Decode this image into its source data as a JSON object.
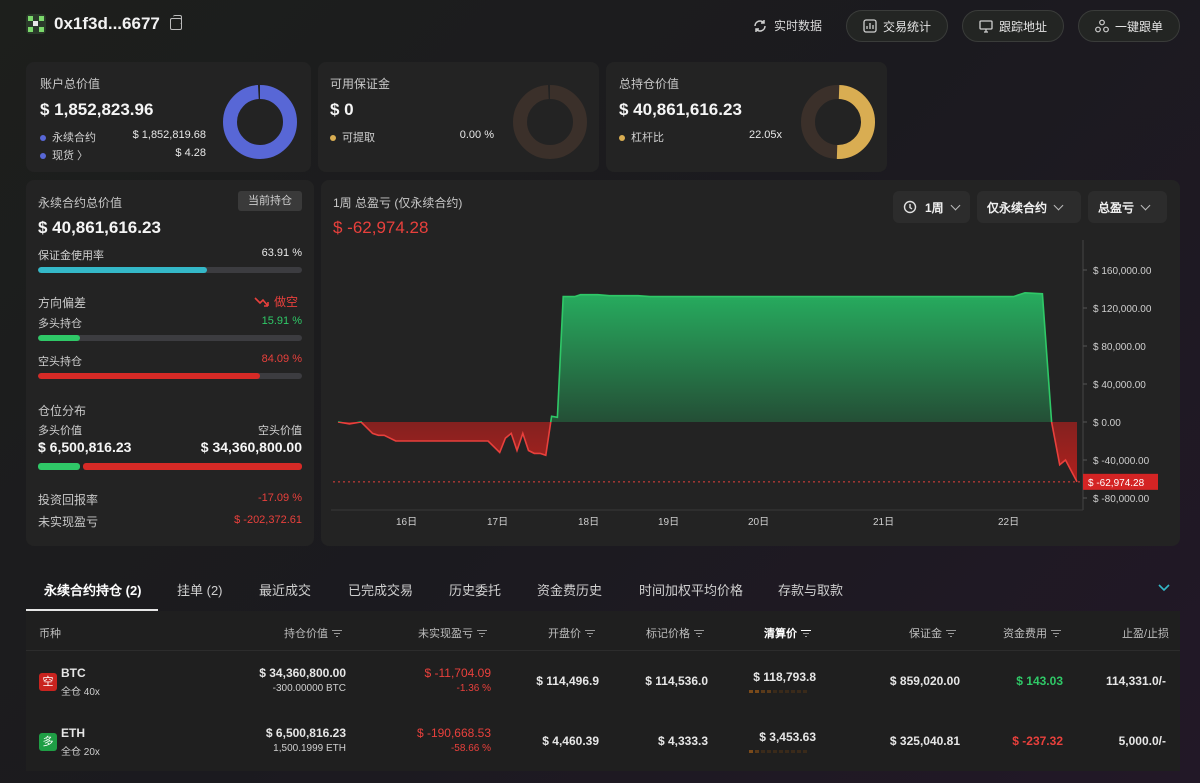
{
  "header": {
    "address": "0x1f3d...6677",
    "realtime_label": "实时数据",
    "buttons": {
      "stats": "交易统计",
      "track": "跟踪地址",
      "copy_trade": "一键跟单"
    }
  },
  "colors": {
    "blue": "#5867d6",
    "gold": "#d9ad52",
    "green": "#2fc867",
    "red": "#e8403c",
    "teal": "#34b8c8"
  },
  "summary": {
    "total": {
      "label": "账户总价值",
      "value": "$ 1,852,823.96",
      "perp_label": "永续合约",
      "perp_value": "$ 1,852,819.68",
      "spot_label": "现货 〉",
      "spot_value": "$ 4.28"
    },
    "margin": {
      "label": "可用保证金",
      "value": "$ 0",
      "withdraw_label": "可提取",
      "withdraw_value": "0.00 %"
    },
    "position": {
      "label": "总持仓价值",
      "value": "$ 40,861,616.23",
      "leverage_label": "杠杆比",
      "leverage_value": "22.05x"
    }
  },
  "perp": {
    "title": "永续合约总价值",
    "badge": "当前持仓",
    "value": "$ 40,861,616.23",
    "margin_usage_label": "保证金使用率",
    "margin_usage_value": "63.91 %",
    "margin_usage_frac": 0.6391,
    "bias_label": "方向偏差",
    "bias_value": "做空",
    "long_label": "多头持仓",
    "long_value": "15.91 %",
    "long_frac": 0.1591,
    "short_label": "空头持仓",
    "short_value": "84.09 %",
    "short_frac": 0.8409,
    "dist_label": "仓位分布",
    "long_value_label": "多头价值",
    "short_value_label": "空头价值",
    "long_amount": "$ 6,500,816.23",
    "short_amount": "$ 34,360,800.00",
    "roi_label": "投资回报率",
    "roi_value": "-17.09 %",
    "upnl_label": "未实现盈亏",
    "upnl_value": "$ -202,372.61"
  },
  "pnl_panel": {
    "title": "1周 总盈亏 (仅永续合约)",
    "value": "$ -62,974.28",
    "dropdowns": {
      "period": "1周",
      "scope": "仅永续合约",
      "metric": "总盈亏"
    }
  },
  "chart_data": {
    "type": "area",
    "x_ticks": [
      "16日",
      "17日",
      "18日",
      "19日",
      "20日",
      "21日",
      "22日"
    ],
    "y_ticks": [
      "$ 160,000.00",
      "$ 120,000.00",
      "$ 80,000.00",
      "$ 40,000.00",
      "$ 0.00",
      "$ -40,000.00",
      "$ -80,000.00"
    ],
    "ylim": [
      -80000,
      160000
    ],
    "current_label": "$ -62,974.28",
    "current_value": -62974.28,
    "x": [
      0,
      0.1,
      0.2,
      0.3,
      0.35,
      0.4,
      0.5,
      0.6,
      0.7,
      0.8,
      0.9,
      1.0,
      1.1,
      1.2,
      1.3,
      1.4,
      1.45,
      1.5,
      1.55,
      1.6,
      1.65,
      1.7,
      1.75,
      1.8,
      1.85,
      1.9,
      1.95,
      2.0,
      2.05,
      2.1,
      2.15,
      2.2,
      2.25,
      2.35,
      2.5,
      2.6,
      2.7,
      3.0,
      3.5,
      4.0,
      4.5,
      5.0,
      5.5,
      5.85,
      5.95,
      6.1,
      6.18,
      6.25,
      6.3,
      6.4
    ],
    "y": [
      0,
      -2000,
      0,
      -12000,
      -14000,
      -14000,
      -20000,
      -20000,
      -20000,
      -20000,
      -20000,
      -20000,
      -20000,
      -20000,
      -20000,
      -32000,
      -17000,
      -12000,
      -30000,
      -12000,
      -30000,
      -33000,
      -33000,
      -35000,
      6000,
      5000,
      132000,
      132000,
      132000,
      134000,
      134000,
      134000,
      134000,
      133000,
      133000,
      133000,
      132000,
      132000,
      132000,
      132000,
      132000,
      132000,
      132000,
      132000,
      136000,
      135000,
      0,
      -45000,
      -40000,
      -62974.28
    ]
  },
  "tabs": [
    "永续合约持仓 (2)",
    "挂单 (2)",
    "最近成交",
    "已完成交易",
    "历史委托",
    "资金费历史",
    "时间加权平均价格",
    "存款与取款"
  ],
  "table": {
    "headers": [
      "币种",
      "持仓价值",
      "未实现盈亏",
      "开盘价",
      "标记价格",
      "清算价",
      "保证金",
      "资金费用",
      "止盈/止损"
    ],
    "rows": [
      {
        "badge": "空",
        "coin": "BTC",
        "mode": "全仓 40x",
        "value": "$ 34,360,800.00",
        "size": "-300.00000 BTC",
        "upnl": "$ -11,704.09",
        "upnl_pct": "-1.36 %",
        "open": "$ 114,496.9",
        "mark": "$ 114,536.0",
        "liq": "$ 118,793.8",
        "margin": "$ 859,020.00",
        "funding": "$ 143.03",
        "tpsl": "114,331.0/-"
      },
      {
        "badge": "多",
        "coin": "ETH",
        "mode": "全仓 20x",
        "value": "$ 6,500,816.23",
        "size": "1,500.1999 ETH",
        "upnl": "$ -190,668.53",
        "upnl_pct": "-58.66 %",
        "open": "$ 4,460.39",
        "mark": "$ 4,333.3",
        "liq": "$ 3,453.63",
        "margin": "$ 325,040.81",
        "funding": "$ -237.32",
        "tpsl": "5,000.0/-"
      }
    ]
  }
}
